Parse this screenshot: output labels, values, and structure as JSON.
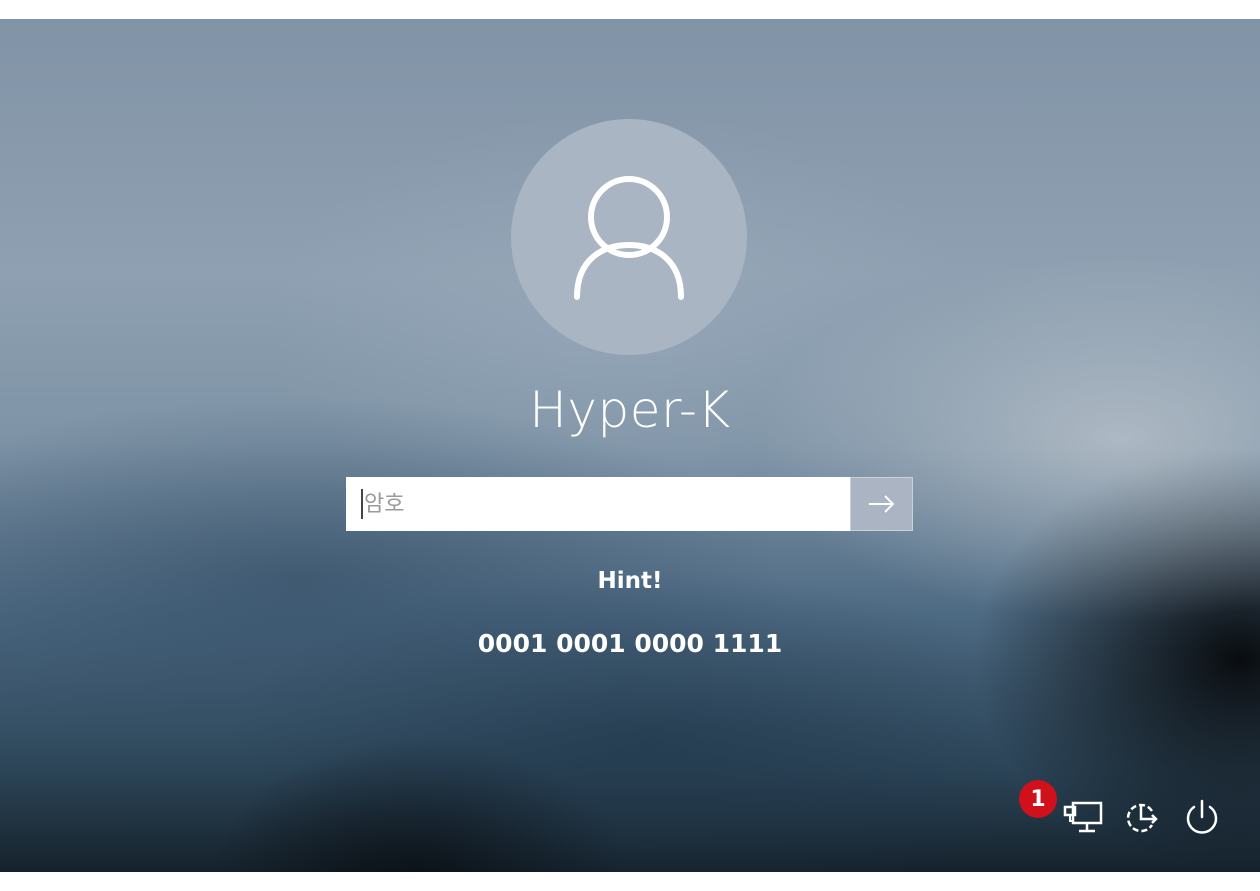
{
  "user": {
    "name": "Hyper-K"
  },
  "password": {
    "placeholder": "암호",
    "value": ""
  },
  "submit": {
    "icon": "arrow-right-icon"
  },
  "hint": {
    "title": "Hint!",
    "text": "0001 0001 0000 1111"
  },
  "annotation": {
    "badge": "1"
  },
  "system_tray": {
    "icons": [
      "network-icon",
      "ease-of-access-icon",
      "power-icon"
    ]
  },
  "colors": {
    "badge": "#d0101a",
    "avatar_bg": "#aab5c4",
    "submit_bg": "#aab4c2"
  }
}
